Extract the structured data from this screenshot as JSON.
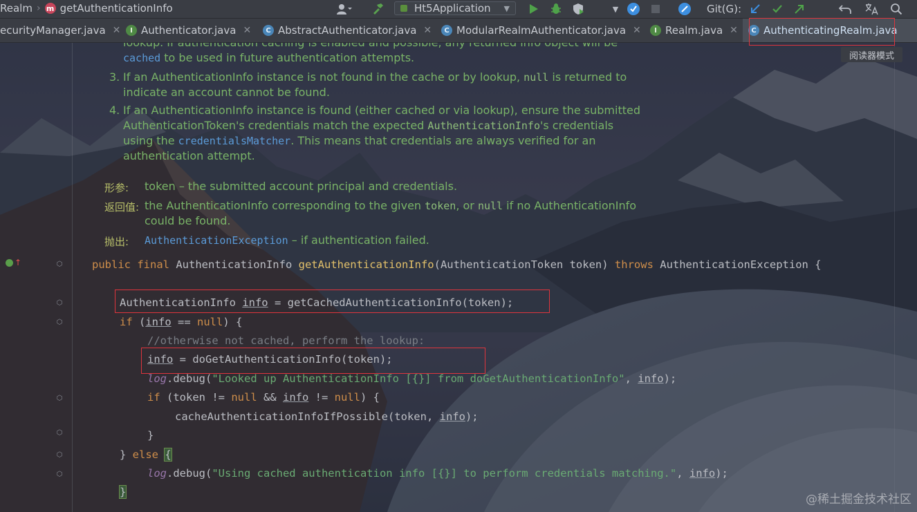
{
  "navbar": {
    "crumb1": "Realm",
    "crumb2_icon": "m",
    "crumb2": "getAuthenticationInfo",
    "run_config": "Ht5Application",
    "git_label": "Git(G):"
  },
  "tabs": [
    {
      "label": "ecurityManager.java",
      "icon": "class-icon"
    },
    {
      "label": "Authenticator.java",
      "icon": "interface-icon"
    },
    {
      "label": "AbstractAuthenticator.java",
      "icon": "class-icon"
    },
    {
      "label": "ModularRealmAuthenticator.java",
      "icon": "class-icon"
    },
    {
      "label": "Realm.java",
      "icon": "interface-icon"
    },
    {
      "label": "AuthenticatingRealm.java",
      "icon": "class-icon"
    }
  ],
  "tab_icon_letters": {
    "interface": "I",
    "class": "C"
  },
  "reader_mode": "阅读器模式",
  "javadoc": {
    "line0a": "lookup. If authentication caching is enabled and possible, any returned info object will be",
    "line0b_code": "cached",
    "line0b_text": " to be used in future authentication attempts.",
    "item3_num": "3.",
    "item3a_pre": "If an AuthenticationInfo instance is not found in the cache or by lookup, ",
    "item3a_code": "null",
    "item3a_post": " is returned to",
    "item3b": "indicate an account cannot be found.",
    "item4_num": "4.",
    "item4a": "If an AuthenticationInfo instance is found (either cached or via lookup), ensure the submitted",
    "item4b_pre": "AuthenticationToken's credentials match the expected ",
    "item4b_code": "AuthenticationInfo",
    "item4b_post": "'s credentials",
    "item4c_pre": "using the ",
    "item4c_link": "credentialsMatcher",
    "item4c_post": ". This means that credentials are always verified for an",
    "item4d": "authentication attempt.",
    "param_tag": "形参:",
    "param_desc": "token – the submitted account principal and credentials.",
    "return_tag": "返回值:",
    "return_pre": "the AuthenticationInfo corresponding to the given ",
    "return_code1": "token",
    "return_mid": ", or ",
    "return_code2": "null",
    "return_post": " if no AuthenticationInfo",
    "return_line2": "could be found.",
    "throws_tag": "抛出:",
    "throws_link": "AuthenticationException",
    "throws_desc": " – if authentication failed."
  },
  "code": {
    "sig_kw1": "public final ",
    "sig_type": "AuthenticationInfo ",
    "sig_fn": "getAuthenticationInfo",
    "sig_params": "(AuthenticationToken token) ",
    "sig_throws": "throws ",
    "sig_ex": "AuthenticationException {",
    "l1_type": "AuthenticationInfo ",
    "l1_var": "info",
    "l1_rest": " = getCachedAuthenticationInfo(token);",
    "l2_if": "if",
    "l2_open": " (",
    "l2_var": "info",
    "l2_op": " == ",
    "l2_null": "null",
    "l2_close": ") {",
    "l3_comment": "//otherwise not cached, perform the lookup:",
    "l4_var": "info",
    "l4_rest": " = doGetAuthenticationInfo(token);",
    "l5_log": "log",
    "l5_call": ".debug(",
    "l5_str": "\"Looked up AuthenticationInfo [{}] from doGetAuthenticationInfo\"",
    "l5_sep": ", ",
    "l5_var": "info",
    "l5_end": ");",
    "l6_if": "if",
    "l6_a": " (token != ",
    "l6_null1": "null",
    "l6_b": " && ",
    "l6_var": "info",
    "l6_c": " != ",
    "l6_null2": "null",
    "l6_d": ") {",
    "l7_call": "cacheAuthenticationInfoIfPossible(token, ",
    "l7_var": "info",
    "l7_end": ");",
    "l8": "}",
    "l9_close": "} ",
    "l9_else": "else",
    "l9_sp": " ",
    "l9_brace": "{",
    "l10_log": "log",
    "l10_call": ".debug(",
    "l10_str": "\"Using cached authentication info [{}] to perform credentials matching.\"",
    "l10_sep": ", ",
    "l10_var": "info",
    "l10_end": ");",
    "l11": "}"
  },
  "watermark": "@稀土掘金技术社区",
  "colors": {
    "keyword": "#cf8e4a",
    "function": "#e3c16a",
    "string": "#6aab73",
    "javadoc": "#79b367",
    "link": "#5b9bd8",
    "highlight_box": "#e0353d"
  }
}
